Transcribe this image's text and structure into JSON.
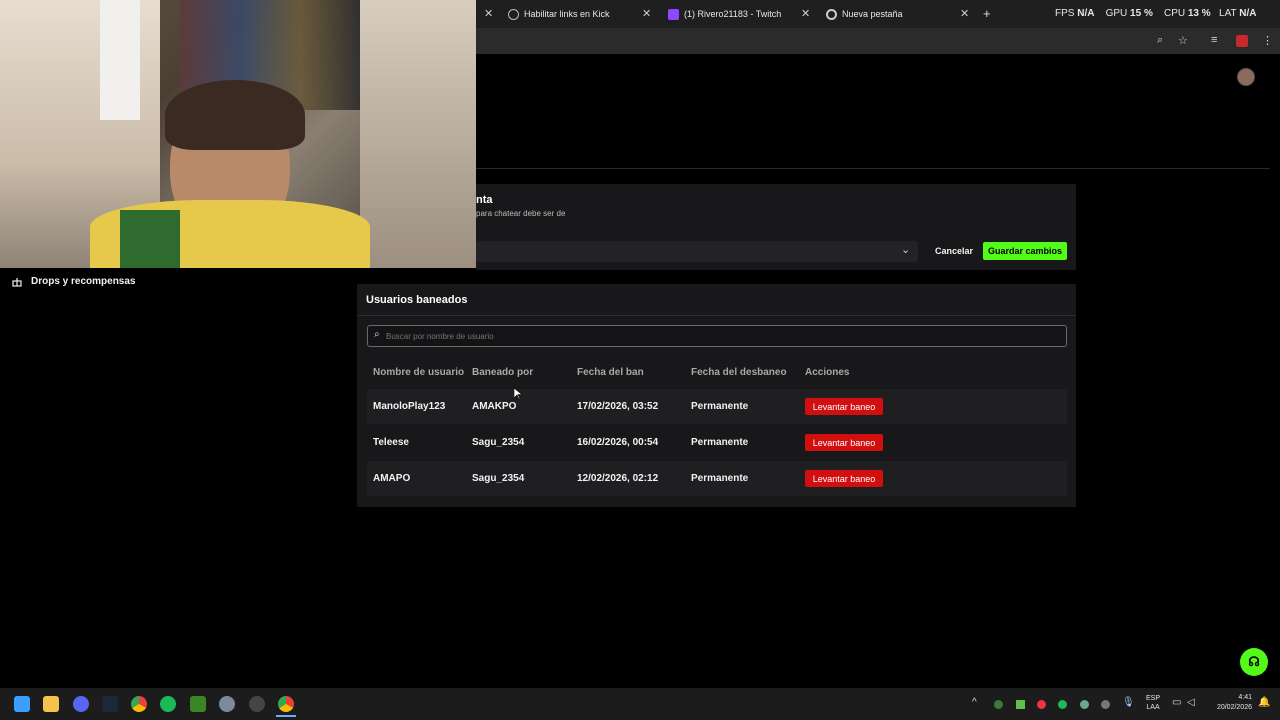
{
  "tabs": [
    {
      "label": "Habilitar links en Kick",
      "icon": "globe-icon"
    },
    {
      "label": "(1) Rivero21183 - Twitch",
      "icon": "twitch-icon"
    },
    {
      "label": "Nueva pestaña",
      "icon": "chrome-icon"
    }
  ],
  "overlay_stats": {
    "fps_label": "FPS",
    "fps_value": "N/A",
    "gpu_label": "GPU",
    "gpu_value": "15 %",
    "cpu_label": "CPU",
    "cpu_value": "13 %",
    "lat_label": "LAT",
    "lat_value": "N/A"
  },
  "sidebar": {
    "drops_label": "Drops y recompensas"
  },
  "settings": {
    "partial_title": "nta",
    "partial_desc": "para chatear debe ser de",
    "cancel_label": "Cancelar",
    "save_label": "Guardar cambios",
    "save_color": "#53fc18"
  },
  "banned": {
    "title": "Usuarios baneados",
    "search_placeholder": "Buscar por nombre de usuario",
    "columns": [
      "Nombre de usuario",
      "Baneado por",
      "Fecha del ban",
      "Fecha del desbaneo",
      "Acciones"
    ],
    "rows": [
      {
        "user": "ManoloPlay123",
        "by": "AMAKPO",
        "ban_date": "17/02/2026, 03:52",
        "unban": "Permanente",
        "action": "Levantar baneo"
      },
      {
        "user": "Teleese",
        "by": "Sagu_2354",
        "ban_date": "16/02/2026, 00:54",
        "unban": "Permanente",
        "action": "Levantar baneo"
      },
      {
        "user": "AMAPO",
        "by": "Sagu_2354",
        "ban_date": "12/02/2026, 02:12",
        "unban": "Permanente",
        "action": "Levantar baneo"
      }
    ],
    "action_color": "#d10f0f"
  },
  "taskbar": {
    "lang_line1": "ESP",
    "lang_line2": "LAA",
    "time": "4:41",
    "date": "20/02/2026"
  }
}
